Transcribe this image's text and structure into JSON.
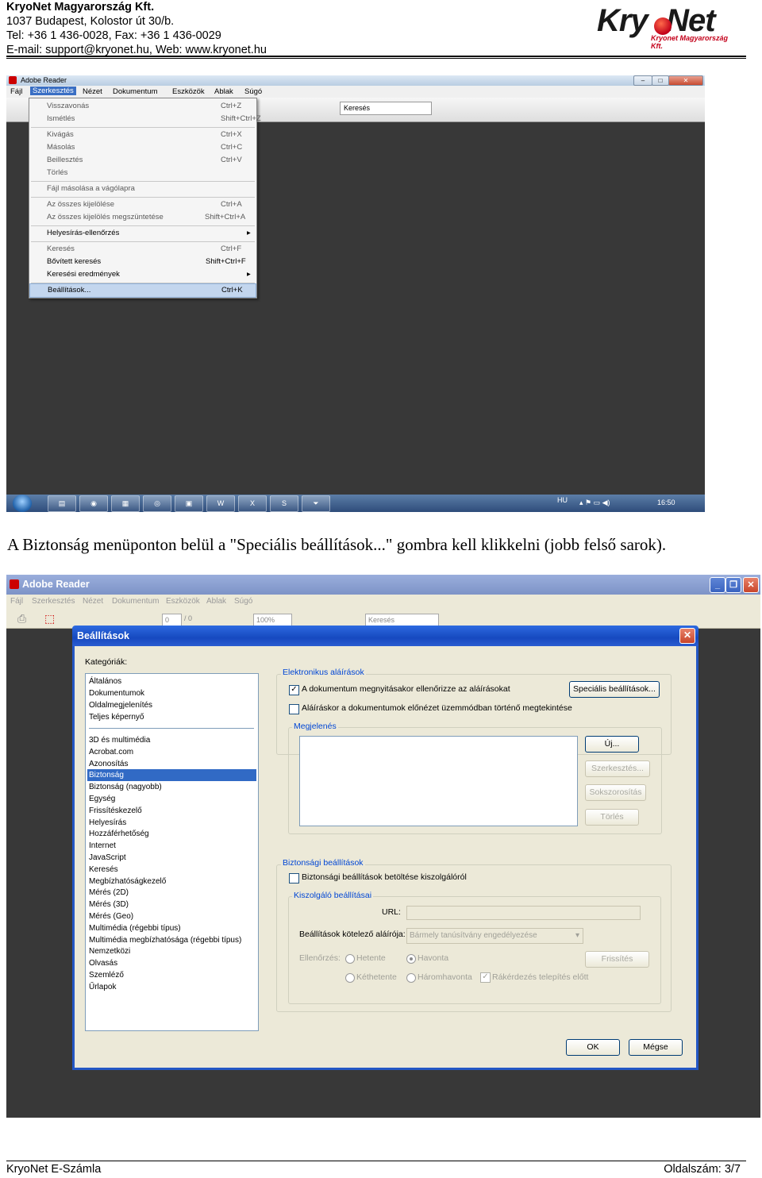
{
  "header": {
    "company": "KryoNet Magyarország Kft.",
    "address": "1037 Budapest, Kolostor út 30/b.",
    "phone": "Tel: +36 1 436-0028, Fax: +36 1 436-0029",
    "contact": "E-mail: support@kryonet.hu, Web: www.kryonet.hu",
    "logo_text": "KryoNet",
    "logo_sub": "Kryonet Magyarország Kft."
  },
  "screenshot1": {
    "title": "Adobe Reader",
    "menubar": [
      "Fájl",
      "Szerkesztés",
      "Nézet",
      "Dokumentum",
      "Eszközök",
      "Ablak",
      "Súgó"
    ],
    "search_placeholder": "Keresés",
    "edit_menu": [
      {
        "label": "Visszavonás",
        "shortcut": "Ctrl+Z"
      },
      {
        "label": "Ismétlés",
        "shortcut": "Shift+Ctrl+Z"
      },
      {
        "label": "Kivágás",
        "shortcut": "Ctrl+X"
      },
      {
        "label": "Másolás",
        "shortcut": "Ctrl+C"
      },
      {
        "label": "Beillesztés",
        "shortcut": "Ctrl+V"
      },
      {
        "label": "Törlés",
        "shortcut": ""
      },
      {
        "label": "Fájl másolása a vágólapra",
        "shortcut": ""
      },
      {
        "label": "Az összes kijelölése",
        "shortcut": "Ctrl+A"
      },
      {
        "label": "Az összes kijelölés megszüntetése",
        "shortcut": "Shift+Ctrl+A"
      },
      {
        "label": "Helyesírás-ellenőrzés",
        "shortcut": ""
      },
      {
        "label": "Keresés",
        "shortcut": "Ctrl+F"
      },
      {
        "label": "Bővített keresés",
        "shortcut": "Shift+Ctrl+F"
      },
      {
        "label": "Keresési eredmények",
        "shortcut": ""
      },
      {
        "label": "Beállítások...",
        "shortcut": "Ctrl+K"
      }
    ],
    "taskbar": {
      "lang": "HU",
      "time": "16:50"
    }
  },
  "caption": "A Biztonság menüponton belül a \"Speciális beállítások...\" gombra kell klikkelni (jobb felső sarok).",
  "screenshot2": {
    "title": "Adobe Reader",
    "menubar": [
      "Fájl",
      "Szerkesztés",
      "Nézet",
      "Dokumentum",
      "Eszközök",
      "Ablak",
      "Súgó"
    ],
    "page_num": "0",
    "page_total": "/ 0",
    "zoom": "100%",
    "search_placeholder": "Keresés",
    "dialog": {
      "title": "Beállítások",
      "categories_label": "Kategóriák:",
      "categories_top": [
        "Általános",
        "Dokumentumok",
        "Oldalmegjelenítés",
        "Teljes képernyő"
      ],
      "categories": [
        "3D és multimédia",
        "Acrobat.com",
        "Azonosítás",
        "Biztonság",
        "Biztonság (nagyobb)",
        "Egység",
        "Frissítéskezelő",
        "Helyesírás",
        "Hozzáférhetőség",
        "Internet",
        "JavaScript",
        "Keresés",
        "Megbízhatóságkezelő",
        "Mérés (2D)",
        "Mérés (3D)",
        "Mérés (Geo)",
        "Multimédia (régebbi típus)",
        "Multimédia megbízhatósága (régebbi típus)",
        "Nemzetközi",
        "Olvasás",
        "Szemléző",
        "Űrlapok"
      ],
      "selected_category": "Biztonság",
      "esign_group": "Elektronikus aláírások",
      "esign_cb1": "A dokumentum megnyitásakor ellenőrizze az aláírásokat",
      "esign_cb2": "Aláíráskor a dokumentumok előnézet üzemmódban történő megtekintése",
      "advanced_btn": "Speciális beállítások...",
      "appearance_group": "Megjelenés",
      "new_btn": "Új...",
      "edit_btn": "Szerkesztés...",
      "duplicate_btn": "Sokszorosítás",
      "delete_btn": "Törlés",
      "security_group": "Biztonsági beállítások",
      "security_cb": "Biztonsági beállítások betöltése kiszolgálóról",
      "server_group": "Kiszolgáló beállításai",
      "url_label": "URL:",
      "signer_label": "Beállítások kötelező aláírója:",
      "signer_value": "Bármely tanúsítvány engedélyezése",
      "check_label": "Ellenőrzés:",
      "weekly": "Hetente",
      "monthly": "Havonta",
      "biweekly": "Kéthetente",
      "quarterly": "Háromhavonta",
      "ask_cb": "Rákérdezés telepítés előtt",
      "refresh_btn": "Frissítés",
      "ok_btn": "OK",
      "cancel_btn": "Mégse"
    }
  },
  "footer": {
    "left": "KryoNet E-Számla",
    "right": "Oldalszám: 3/7"
  }
}
